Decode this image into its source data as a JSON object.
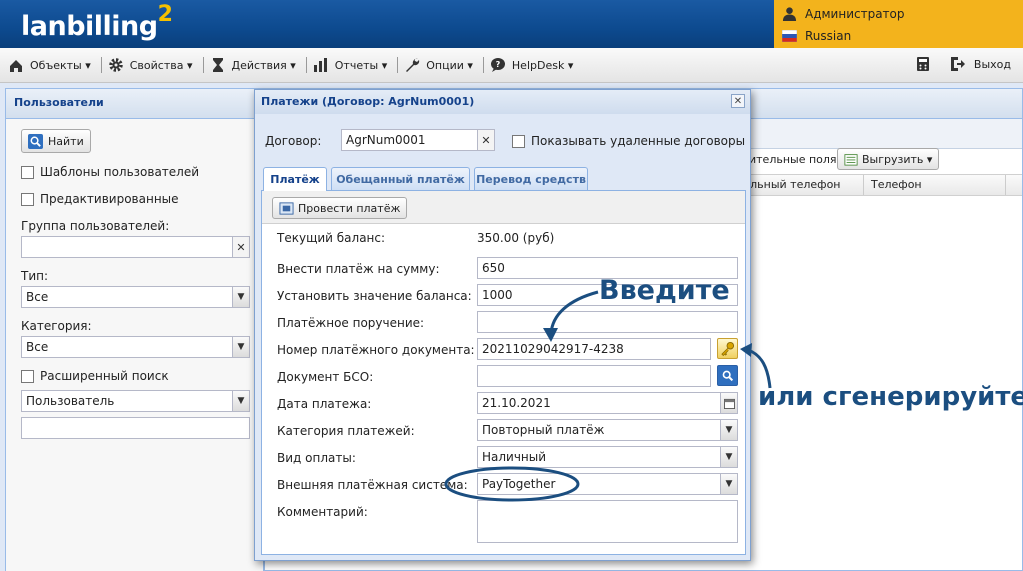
{
  "app": {
    "logo": "lanbilling",
    "logo_sup": "2"
  },
  "user": {
    "name": "Администратор",
    "language": "Russian"
  },
  "menu": [
    {
      "label": "Объекты",
      "icon": "tree-icon"
    },
    {
      "label": "Свойства",
      "icon": "gear-icon"
    },
    {
      "label": "Действия",
      "icon": "hourglass-icon"
    },
    {
      "label": "Отчеты",
      "icon": "bar-chart-icon"
    },
    {
      "label": "Опции",
      "icon": "wrench-icon"
    },
    {
      "label": "HelpDesk",
      "icon": "speech-bubble-icon"
    }
  ],
  "toolbar_right": {
    "exit_label": "Выход"
  },
  "users_panel": {
    "title": "Пользователи",
    "find_button": "Найти",
    "templates_checkbox": "Шаблоны пользователей",
    "preactivated_checkbox": "Предактивированные",
    "group_label": "Группа пользователей:",
    "group_value": "",
    "type_label": "Тип:",
    "type_value": "Все",
    "category_label": "Категория:",
    "category_value": "Все",
    "advanced_search_checkbox": "Расширенный поиск",
    "search_field_value": "Пользователь",
    "search_text_value": ""
  },
  "bg_grid": {
    "fields_button": "ительные поля",
    "export_button": "Выгрузить",
    "columns": [
      "ильный телефон",
      "Телефон"
    ]
  },
  "dialog": {
    "title": "Платежи (Договор: AgrNum0001)",
    "contract_label": "Договор:",
    "contract_value": "AgrNum0001",
    "show_deleted_label": "Показывать удаленные договоры",
    "tabs": [
      "Платёж",
      "Обещанный платёж",
      "Перевод средств"
    ],
    "submit_button": "Провести платёж",
    "current_balance_label": "Текущий баланс:",
    "current_balance_value": "350.00 (руб)",
    "pay_amount_label": "Внести платёж на сумму:",
    "pay_amount_value": "650",
    "set_balance_label": "Установить значение баланса:",
    "set_balance_value": "1000",
    "payment_order_label": "Платёжное поручение:",
    "payment_order_value": "",
    "doc_number_label": "Номер платёжного документа:",
    "doc_number_value": "20211029042917-4238",
    "bso_label": "Документ БСО:",
    "bso_value": "",
    "date_label": "Дата платежа:",
    "date_value": "21.10.2021",
    "category_label": "Категория платежей:",
    "category_value": "Повторный платёж",
    "pay_type_label": "Вид оплаты:",
    "pay_type_value": "Наличный",
    "ext_system_label": "Внешняя платёжная система:",
    "ext_system_value": "PayTogether",
    "comment_label": "Комментарий:",
    "comment_value": ""
  },
  "annotations": {
    "enter": "Введите",
    "generate": "или сгенерируйте"
  },
  "colors": {
    "header_blue": "#0d4a8f",
    "user_orange": "#f3b31c",
    "annotation": "#1b4e80",
    "panel_title": "#15428b"
  }
}
